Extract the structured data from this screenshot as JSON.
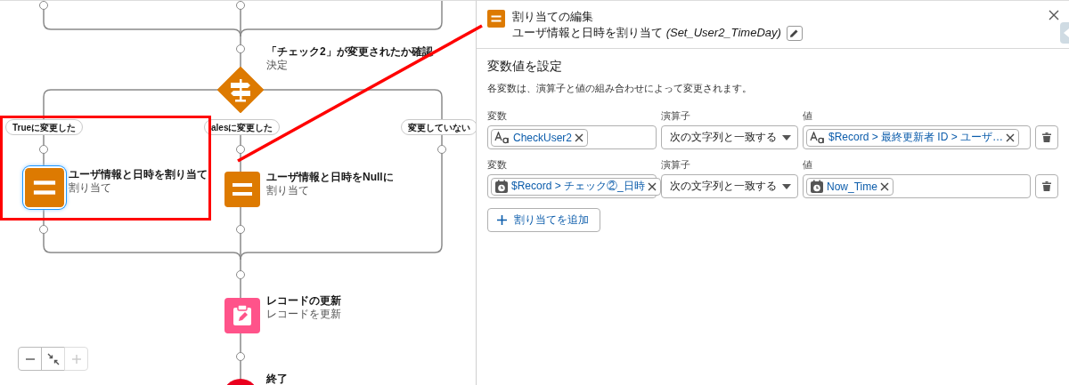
{
  "canvas": {
    "decision": {
      "title": "「チェック2」が変更されたか確認",
      "type_label": "決定"
    },
    "outcomes": [
      {
        "label": "Trueに変更した"
      },
      {
        "label": "alesに変更した"
      },
      {
        "label": "変更していない"
      }
    ],
    "branch_nodes": [
      {
        "title": "ユーザ情報と日時を割り当て",
        "type_label": "割り当て",
        "selected": true
      },
      {
        "title": "ユーザ情報と日時をNullに",
        "type_label": "割り当て",
        "selected": false
      }
    ],
    "update_node": {
      "title": "レコードの更新",
      "type_label": "レコードを更新"
    },
    "end_node": {
      "title": "終了"
    },
    "zoom_controls": [
      {
        "kind": "zoom_out",
        "disabled": false
      },
      {
        "kind": "fit",
        "disabled": false
      },
      {
        "kind": "zoom_in",
        "disabled": true
      }
    ]
  },
  "panel": {
    "title": "割り当ての編集",
    "subtitle": "ユーザ情報と日時を割り当て",
    "api_name": "(Set_User2_TimeDay)",
    "section_title": "変数値を設定",
    "description": "各変数は、演算子と値の組み合わせによって変更されます。",
    "assignments": [
      {
        "variable_label": "変数",
        "variable": {
          "kind": "text",
          "label": "CheckUser2"
        },
        "operator_label": "演算子",
        "operator": "次の文字列と一致する",
        "value_label": "値",
        "value": {
          "kind": "text",
          "label": "$Record > 最終更新者 ID > ユーザ…"
        }
      },
      {
        "variable_label": "変数",
        "variable": {
          "kind": "datetime",
          "label": "$Record > チェック②_日時"
        },
        "operator_label": "演算子",
        "operator": "次の文字列と一致する",
        "value_label": "値",
        "value": {
          "kind": "datetime",
          "label": "Now_Time"
        }
      }
    ],
    "add_button": "割り当てを追加"
  }
}
